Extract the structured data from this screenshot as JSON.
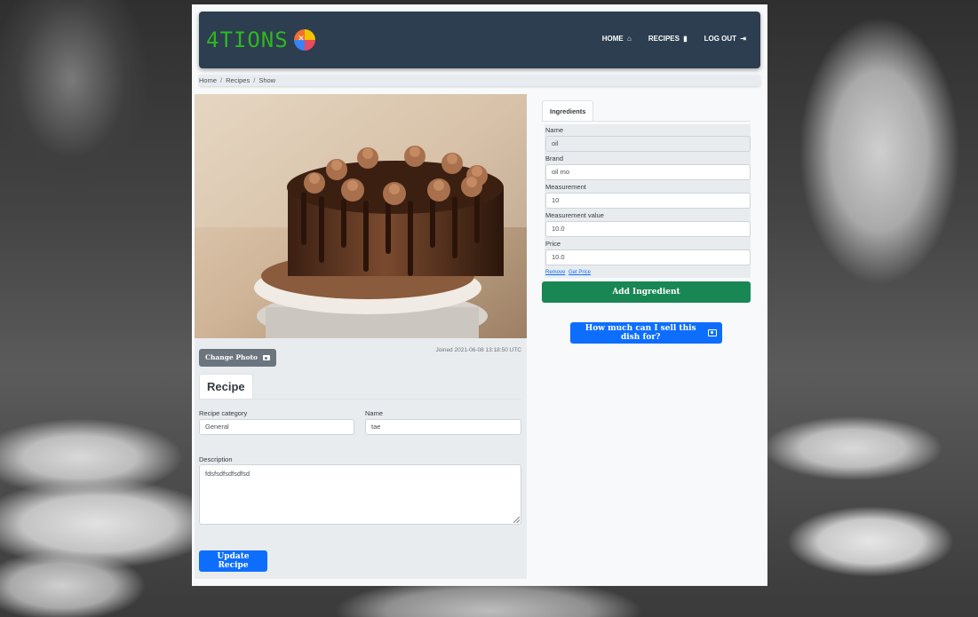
{
  "nav": {
    "brand": "4TIONS",
    "links": [
      {
        "label": "HOME",
        "icon": "home-icon",
        "glyph": "⌂"
      },
      {
        "label": "RECIPES",
        "icon": "document-icon",
        "glyph": "▮"
      },
      {
        "label": "LOG OUT",
        "icon": "logout-icon",
        "glyph": "⇥"
      }
    ]
  },
  "breadcrumb": [
    "Home",
    "Recipes",
    "Show"
  ],
  "recipe": {
    "change_photo_label": "Change Photo",
    "joined_text": "Joined 2021-06-08 13:18:50 UTC",
    "tab_label": "Recipe",
    "category_label": "Recipe category",
    "category_value": "General",
    "name_label": "Name",
    "name_value": "tae",
    "description_label": "Description",
    "description_value": "fdsfsdfsdfsdfsd",
    "update_label": "Update Recipe"
  },
  "ingredients": {
    "tab_label": "Ingredients",
    "fields": [
      {
        "label": "Name",
        "value": "oil",
        "disabled": true
      },
      {
        "label": "Brand",
        "value": "oil mo",
        "disabled": false
      },
      {
        "label": "Measurement",
        "value": "10",
        "disabled": false
      },
      {
        "label": "Measurement value",
        "value": "10.0",
        "disabled": false
      },
      {
        "label": "Price",
        "value": "10.0",
        "disabled": false
      }
    ],
    "remove_link": "Remove",
    "get_price_link": "Get Price",
    "add_label": "Add Ingredient",
    "sell_label": "How much can I sell this dish for?"
  },
  "colors": {
    "navbar": "#2c3e50",
    "brand": "#2fb81e",
    "primary": "#0d6efd",
    "success": "#198754",
    "secondary": "#6c757d"
  }
}
